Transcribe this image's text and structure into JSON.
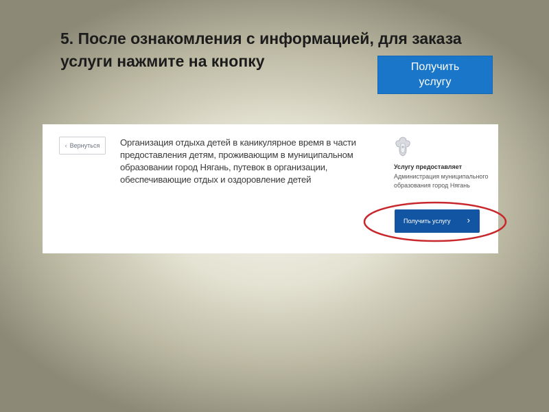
{
  "slide": {
    "title": "5. После ознакомления с информацией, для заказа услуги нажмите на кнопку",
    "hint_button_label": "Получить услугу"
  },
  "portal": {
    "back_label": "Вернуться",
    "back_icon": "chevron-left-icon",
    "service_title": "Организация отдыха детей в каникулярное время в части предоставления детям, проживающим в муниципальном образовании город Нягань, путевок в организации, обеспечивающие отдых и оздоровление детей",
    "emblem_icon": "coat-of-arms-icon",
    "provider_label": "Услугу предоставляет",
    "provider_name": "Администрация муниципального образования город Нягань",
    "get_service_label": "Получить услугу",
    "get_service_icon": "chevron-right-icon"
  },
  "colors": {
    "hint_button": "#1976c8",
    "portal_button": "#1256a3",
    "highlight": "#c8282c"
  }
}
